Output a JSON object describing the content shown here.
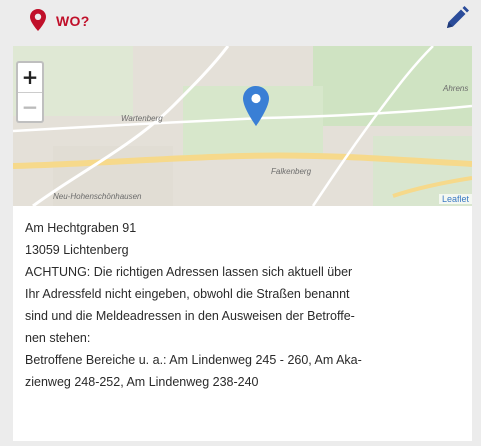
{
  "header": {
    "title": "WO?",
    "pin_icon": "map-pin-icon",
    "edit_icon": "pencil-icon",
    "accent": "#c0102a",
    "edit_color": "#2b4c9a"
  },
  "map": {
    "zoom_in": "+",
    "zoom_out": "−",
    "attribution": "Leaflet",
    "labels": {
      "l1": "Wartenberg",
      "l2": "Ahrens",
      "l3": "Falkenberg",
      "l4": "Neu-Hohenschönhausen"
    },
    "marker_color": "#3a7fd5"
  },
  "address": {
    "lines": [
      "Am Hechtgraben 91",
      "13059 Lichtenberg",
      "ACHTUNG: Die richtigen Adressen lassen sich aktuell über",
      "Ihr Adressfeld nicht eingeben, obwohl die Straßen benannt",
      "sind und die Meldeadressen in den Ausweisen der Betroffe-",
      "nen stehen:",
      "Betroffene Bereiche u. a.: Am Lindenweg 245 - 260, Am Aka-",
      "zienweg 248-252, Am Lindenweg 238-240"
    ]
  }
}
